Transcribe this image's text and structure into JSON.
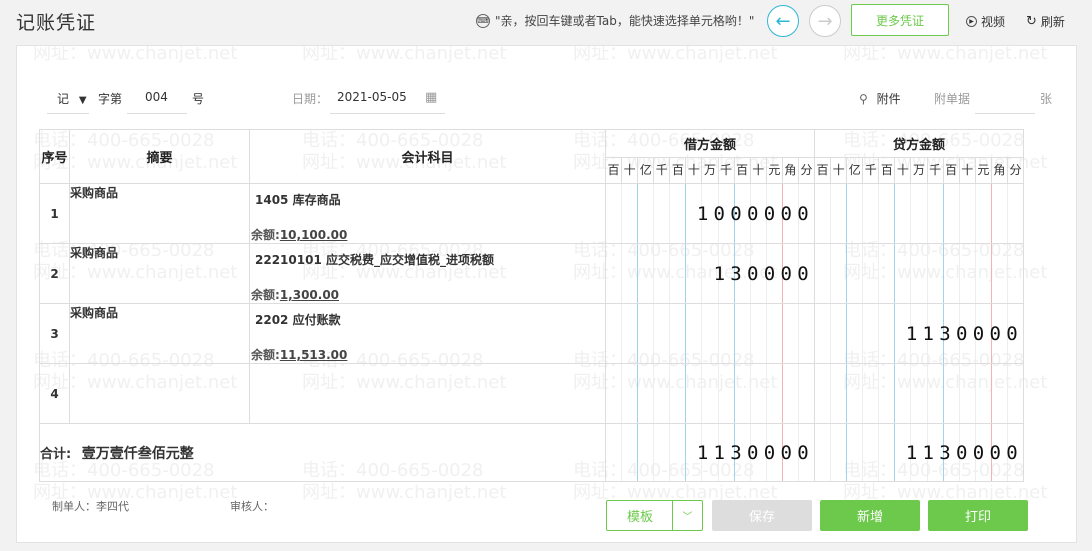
{
  "header": {
    "title": "记账凭证",
    "hint": "\"亲，按回车键或者Tab，能快速选择单元格哟！\"",
    "more_button": "更多凭证",
    "video_label": "视频",
    "refresh_label": "刷新"
  },
  "watermark": {
    "phone": "电话：400-665-0028",
    "site": "网址：www.chanjet.net"
  },
  "voucher_meta": {
    "type": "记",
    "word_label": "字第",
    "number": "004",
    "number_suffix": "号",
    "date_label": "日期：",
    "date": "2021-05-05",
    "attachment_label": "附件",
    "doc_count_label": "附单据",
    "doc_count_unit": "张"
  },
  "table": {
    "headers": {
      "seq": "序号",
      "summary": "摘要",
      "account": "会计科目",
      "debit": "借方金额",
      "credit": "贷方金额"
    },
    "digit_units": [
      "百",
      "十",
      "亿",
      "千",
      "百",
      "十",
      "万",
      "千",
      "百",
      "十",
      "元",
      "角",
      "分"
    ],
    "balance_label": "余额:",
    "rows": [
      {
        "seq": "1",
        "summary": "采购商品",
        "account": "1405 库存商品",
        "balance": "10,100.00",
        "debit": "1000000",
        "credit": ""
      },
      {
        "seq": "2",
        "summary": "采购商品",
        "account": "22210101 应交税费_应交增值税_进项税额",
        "balance": "1,300.00",
        "debit": "130000",
        "credit": ""
      },
      {
        "seq": "3",
        "summary": "采购商品",
        "account": "2202 应付账款",
        "balance": "11,513.00",
        "debit": "",
        "credit": "1130000"
      },
      {
        "seq": "4",
        "summary": "",
        "account": "",
        "balance": "",
        "debit": "",
        "credit": ""
      }
    ],
    "total_label": "合计:",
    "total_text": "壹万壹仟叁佰元整",
    "total_debit": "1130000",
    "total_credit": "1130000"
  },
  "footer": {
    "maker_label": "制单人：",
    "maker": "李四代",
    "reviewer_label": "审核人："
  },
  "buttons": {
    "template": "模板",
    "save": "保存",
    "add": "新增",
    "print": "打印"
  }
}
